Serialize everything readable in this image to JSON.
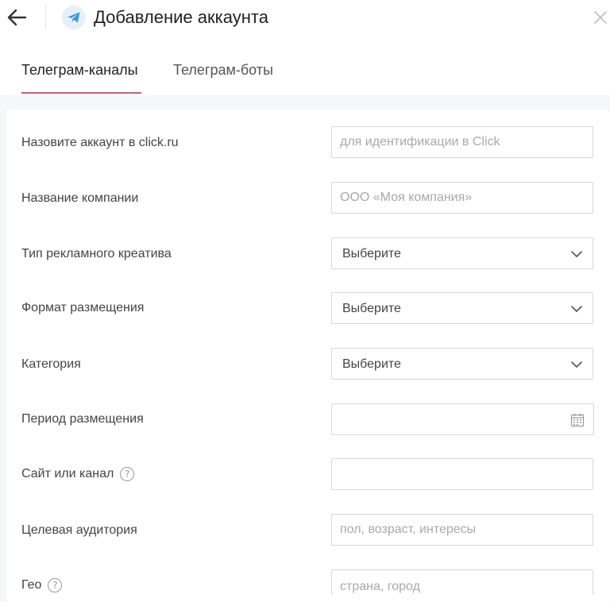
{
  "header": {
    "title": "Добавление аккаунта"
  },
  "tabs": [
    {
      "label": "Телеграм-каналы",
      "active": true
    },
    {
      "label": "Телеграм-боты",
      "active": false
    }
  ],
  "form": {
    "account_name": {
      "label": "Назовите аккаунт в click.ru",
      "placeholder": "для идентификации в Click"
    },
    "company_name": {
      "label": "Название компании",
      "placeholder": "ООО «Моя компания»"
    },
    "creative_type": {
      "label": "Тип рекламного креатива",
      "value": "Выберите"
    },
    "placement_format": {
      "label": "Формат размещения",
      "value": "Выберите"
    },
    "category": {
      "label": "Категория",
      "value": "Выберите"
    },
    "placement_period": {
      "label": "Период размещения",
      "value": ""
    },
    "site_or_channel": {
      "label": "Сайт или канал",
      "value": ""
    },
    "target_audience": {
      "label": "Целевая аудитория",
      "placeholder": "пол, возраст, интересы"
    },
    "geo": {
      "label": "Гео",
      "placeholder": "страна, город"
    }
  },
  "icons": {
    "back": "arrow-left-icon",
    "logo": "telegram-icon",
    "close": "close-icon",
    "chevron": "chevron-down-icon",
    "calendar": "calendar-icon",
    "help": "help-icon"
  },
  "colors": {
    "accent_underline": "#c9636a",
    "telegram_blue": "#3a9bd9",
    "page_background": "#f5f7fa",
    "border": "#d7d7d7",
    "placeholder": "#a9a9a9"
  }
}
